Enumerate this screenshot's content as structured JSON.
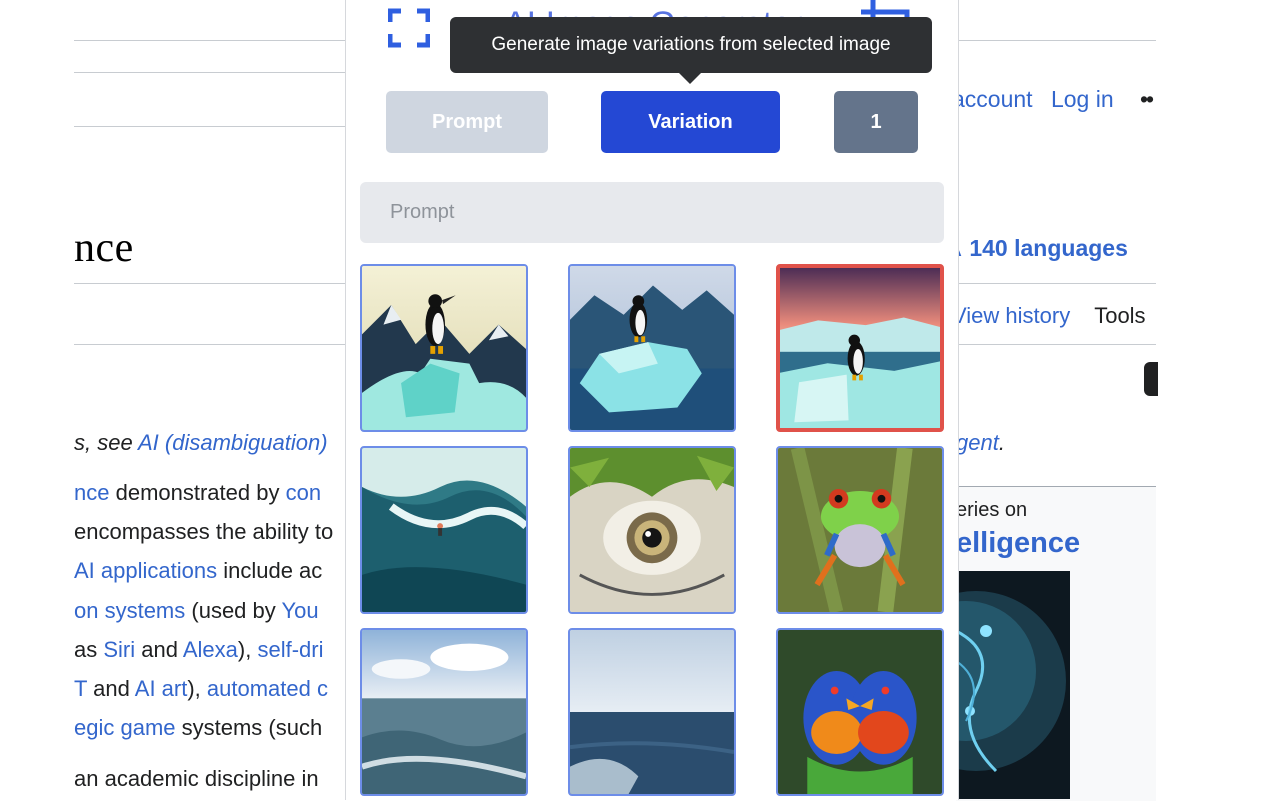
{
  "wiki": {
    "title_fragment": "nce",
    "personal_links": [
      "account",
      "Log in"
    ],
    "more_menu": "••",
    "languages_glyph": "A",
    "languages": "140 languages",
    "view_history": "View history",
    "tools": "Tools",
    "hatnote_left_prefix": "s, see ",
    "hatnote_left_link": "AI (disambiguation)",
    "hatnote_right_link": "gent",
    "hatnote_right_suffix": ".",
    "body_lines": [
      [
        {
          "t": "nce",
          "link": true
        },
        {
          "t": " demonstrated by ",
          "link": false
        },
        {
          "t": "con",
          "link": true
        }
      ],
      [
        {
          "t": "encompasses the ability to",
          "link": false
        }
      ],
      [
        {
          "t": "AI applications",
          "link": true
        },
        {
          "t": " include ac",
          "link": false
        }
      ],
      [
        {
          "t": "on systems",
          "link": true
        },
        {
          "t": " (used by ",
          "link": false
        },
        {
          "t": "You",
          "link": true
        }
      ],
      [
        {
          "t": "as ",
          "link": false
        },
        {
          "t": "Siri",
          "link": true
        },
        {
          "t": " and ",
          "link": false
        },
        {
          "t": "Alexa",
          "link": true
        },
        {
          "t": "), ",
          "link": false
        },
        {
          "t": "self-dri",
          "link": true
        }
      ],
      [
        {
          "t": "T",
          "link": true
        },
        {
          "t": " and ",
          "link": false
        },
        {
          "t": "AI art",
          "link": true
        },
        {
          "t": "), ",
          "link": false
        },
        {
          "t": "automated c",
          "link": true
        }
      ],
      [
        {
          "t": "egic game",
          "link": true
        },
        {
          "t": " systems (such",
          "link": false
        }
      ],
      [
        {
          "t": "an academic discipline in",
          "link": false
        }
      ]
    ],
    "infobox_series": "eries on",
    "infobox_title": "elligence"
  },
  "popup": {
    "header_title": "AI Image Generator",
    "tooltip": "Generate image variations from selected image",
    "buttons": {
      "prompt": "Prompt",
      "variation": "Variation",
      "count": "1"
    },
    "active_mode": "Variation",
    "prompt_placeholder": "Prompt",
    "prompt_value": "",
    "images": [
      {
        "name": "penguin-mountains",
        "subject": "penguin on ice with mountains",
        "selected": false
      },
      {
        "name": "penguin-iceberg",
        "subject": "penguin on iceberg",
        "selected": false
      },
      {
        "name": "penguin-sunset",
        "subject": "penguin on ice at sunset",
        "selected": true
      },
      {
        "name": "surfer-wave",
        "subject": "surfer on wave",
        "selected": false
      },
      {
        "name": "bird-eye",
        "subject": "bird eye close-up",
        "selected": false
      },
      {
        "name": "tree-frog",
        "subject": "red-eyed tree frog",
        "selected": false
      },
      {
        "name": "ocean-shore",
        "subject": "ocean shore",
        "selected": false
      },
      {
        "name": "open-sea",
        "subject": "open sea",
        "selected": false
      },
      {
        "name": "lorikeets",
        "subject": "two lorikeets",
        "selected": false
      }
    ]
  },
  "colors": {
    "accent": "#2448d4",
    "prompt_button": "#cfd6e0",
    "count_button": "#64748b",
    "selected_border": "#e0524a",
    "thumb_border": "#6d8de8",
    "tooltip_bg": "#2e3033",
    "wiki_link": "#3366cc"
  }
}
